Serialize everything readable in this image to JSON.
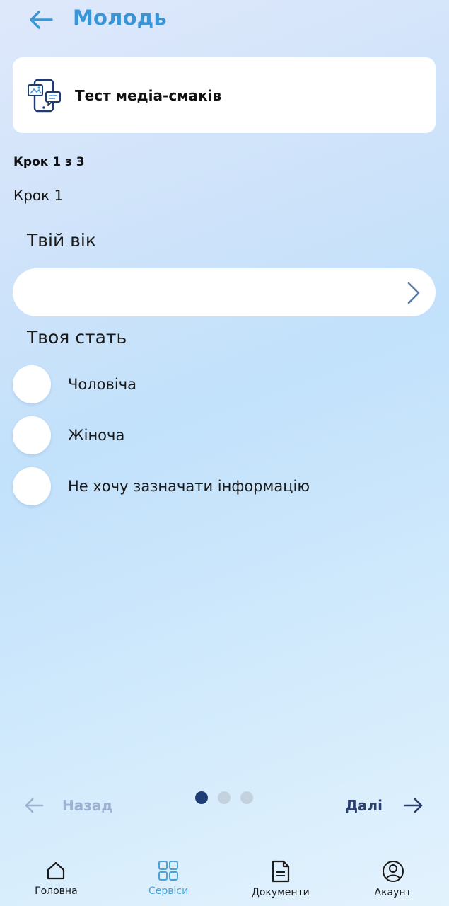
{
  "header": {
    "title": "Молодь"
  },
  "service": {
    "title": "Тест медіа-смаків",
    "icon": "phone-chat-icon"
  },
  "steps": {
    "counter": "Крок 1 з 3",
    "label": "Крок 1"
  },
  "age_question": {
    "label": "Твій вік",
    "value": ""
  },
  "gender_question": {
    "label": "Твоя стать",
    "options": [
      "Чоловіча",
      "Жіноча",
      "Не хочу зазначати інформацію"
    ]
  },
  "pager": {
    "prev_label": "Назад",
    "next_label": "Далі",
    "current_page": 1,
    "total_pages": 3
  },
  "bottom_nav": {
    "items": [
      {
        "label": "Головна",
        "icon": "home-icon"
      },
      {
        "label": "Сервіси",
        "icon": "grid-icon",
        "active": true
      },
      {
        "label": "Документи",
        "icon": "document-icon"
      },
      {
        "label": "Акаунт",
        "icon": "user-icon"
      }
    ]
  },
  "colors": {
    "accent": "#3a95d6",
    "navy": "#1f3d75",
    "muted": "#9cb0cf"
  }
}
